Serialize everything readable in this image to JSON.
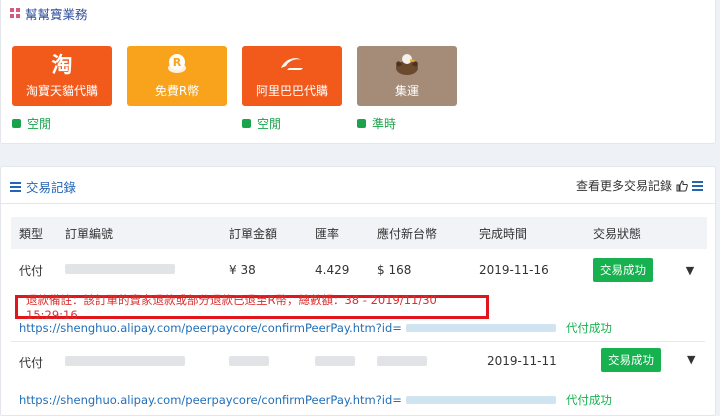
{
  "services": {
    "title": "幫幫寶業務",
    "tiles": [
      {
        "label": "淘寶天貓代購",
        "glyph": "淘",
        "color": "#f25a1c",
        "status": "空閒"
      },
      {
        "label": "免費R幣",
        "glyph": "R",
        "color": "#f8a31b",
        "status": ""
      },
      {
        "label": "阿里巴巴代購",
        "glyph": "ali",
        "color": "#f25a1c",
        "status": "空閒"
      },
      {
        "label": "集運",
        "glyph": "eagle",
        "color": "#a48c79",
        "status": "準時"
      }
    ]
  },
  "records": {
    "title": "交易記錄",
    "more_link": "查看更多交易記錄",
    "columns": [
      "類型",
      "訂單編號",
      "訂單金額",
      "匯率",
      "應付新台幣",
      "完成時間",
      "交易狀態"
    ],
    "rows": [
      {
        "type": "代付",
        "amount": "¥ 38",
        "rate": "4.429",
        "twd": "$ 168",
        "time": "2019-11-16",
        "status": "交易成功"
      },
      {
        "type": "代付",
        "amount": "",
        "rate": "",
        "twd": "",
        "time": "2019-11-11",
        "status": "交易成功"
      }
    ],
    "refund_note": "退款備註：該訂單的賣家退款或部分退款已退至R幣，總數額：38 - 2019/11/30 15:29:16",
    "payment_links": [
      {
        "url": "https://shenghuo.alipay.com/peerpaycore/confirmPeerPay.htm?id=",
        "result": "代付成功"
      },
      {
        "url": "https://shenghuo.alipay.com/peerpaycore/confirmPeerPay.htm?id=",
        "result": "代付成功"
      }
    ]
  }
}
